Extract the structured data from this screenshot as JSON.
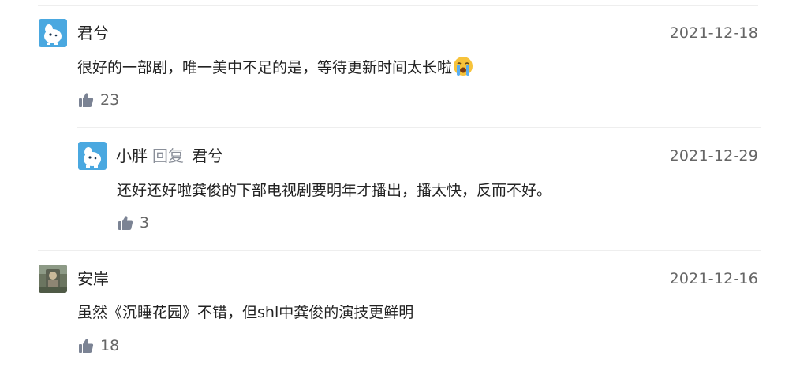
{
  "comments": [
    {
      "username": "君兮",
      "date": "2021-12-18",
      "text": "很好的一部剧，唯一美中不足的是，等待更新时间太长啦",
      "emoji": "loudly-crying-face-emoji",
      "likes": "23",
      "avatar": "blue-dog-avatar",
      "replies": [
        {
          "username": "小胖",
          "reply_word": "回复",
          "reply_to": "君兮",
          "date": "2021-12-29",
          "text": "还好还好啦龚俊的下部电视剧要明年才播出，播太快，反而不好。",
          "likes": "3",
          "avatar": "blue-dog-avatar"
        }
      ]
    },
    {
      "username": "安岸",
      "date": "2021-12-16",
      "text": "虽然《沉睡花园》不错，但shl中龚俊的演技更鲜明",
      "likes": "18",
      "avatar": "photo-avatar"
    }
  ],
  "colors": {
    "text": "#222222",
    "muted": "#666666",
    "reply_word": "#8a8f99",
    "thumb_icon": "#7b8394",
    "divider": "#eeeeee",
    "avatar_blue": "#4aa8e0"
  }
}
